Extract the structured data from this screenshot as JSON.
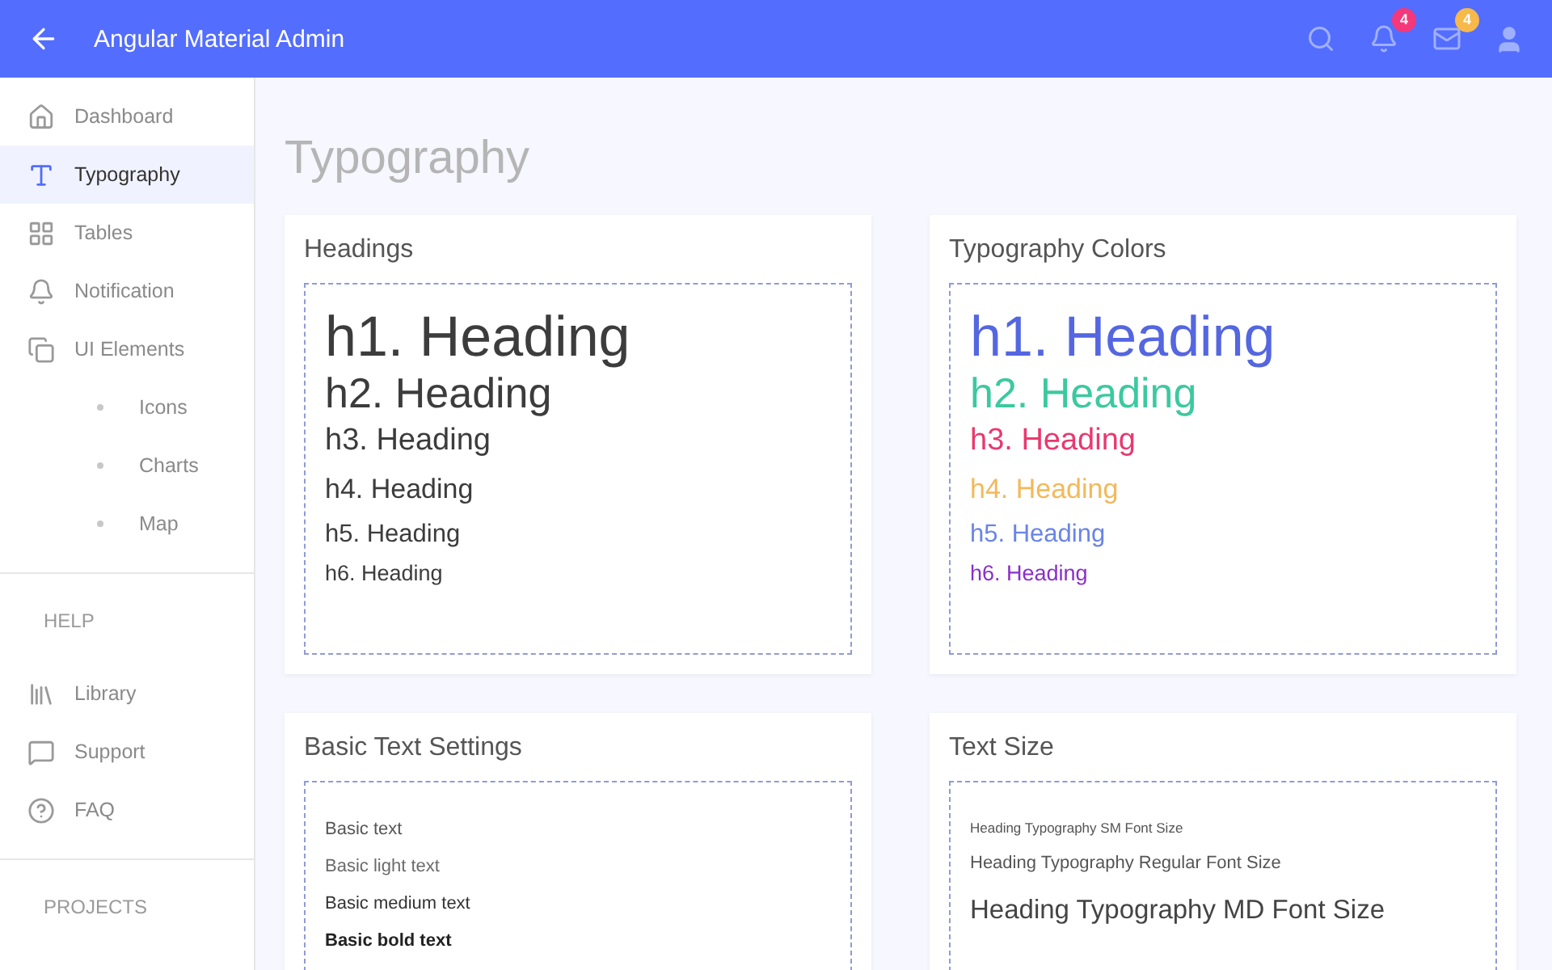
{
  "header": {
    "title": "Angular Material Admin",
    "badges": [
      {
        "kind": "notifications",
        "count": "4",
        "color": "#f4387a"
      },
      {
        "kind": "messages",
        "count": "4",
        "color": "#f6b94a"
      }
    ]
  },
  "sidebar": {
    "items": [
      {
        "kind": "link",
        "label": "Dashboard",
        "selected": false
      },
      {
        "kind": "link",
        "label": "Typography",
        "selected": true
      },
      {
        "kind": "link",
        "label": "Tables",
        "selected": false
      },
      {
        "kind": "link",
        "label": "Notification",
        "selected": false
      },
      {
        "kind": "link",
        "label": "UI Elements",
        "selected": false
      },
      {
        "kind": "sub",
        "label": "Icons",
        "selected": false
      },
      {
        "kind": "sub",
        "label": "Charts",
        "selected": false
      },
      {
        "kind": "sub",
        "label": "Map",
        "selected": false
      },
      {
        "kind": "divider"
      },
      {
        "kind": "header",
        "label": "HELP"
      },
      {
        "kind": "link",
        "label": "Library",
        "selected": false
      },
      {
        "kind": "link",
        "label": "Support",
        "selected": false
      },
      {
        "kind": "link",
        "label": "FAQ",
        "selected": false
      },
      {
        "kind": "divider"
      },
      {
        "kind": "header",
        "label": "PROJECTS"
      }
    ]
  },
  "page_title": "Typography",
  "cards": [
    {
      "kind": "headings",
      "title": "Headings",
      "lines": [
        {
          "text": "h1. Heading",
          "color": "#3c3c3c"
        },
        {
          "text": "h2. Heading",
          "color": "#3c3c3c"
        },
        {
          "text": "h3. Heading",
          "color": "#3c3c3c"
        },
        {
          "text": "h4. Heading",
          "color": "#3c3c3c"
        },
        {
          "text": "h5. Heading",
          "color": "#3c3c3c"
        },
        {
          "text": "h6. Heading",
          "color": "#3c3c3c"
        }
      ]
    },
    {
      "kind": "headings",
      "title": "Typography Colors",
      "lines": [
        {
          "text": "h1. Heading",
          "color": "#5466e0"
        },
        {
          "text": "h2. Heading",
          "color": "#3cc9a0"
        },
        {
          "text": "h3. Heading",
          "color": "#e9386f"
        },
        {
          "text": "h4. Heading",
          "color": "#f3b95a"
        },
        {
          "text": "h5. Heading",
          "color": "#6a84e6"
        },
        {
          "text": "h6. Heading",
          "color": "#8a2fc8"
        }
      ]
    },
    {
      "kind": "text",
      "title": "Basic Text Settings",
      "lines": [
        {
          "kind": "regular",
          "text": "Basic text"
        },
        {
          "kind": "light",
          "text": "Basic light text"
        },
        {
          "kind": "medium",
          "text": "Basic medium text"
        },
        {
          "kind": "bold",
          "text": "Basic bold text"
        }
      ]
    },
    {
      "kind": "text",
      "title": "Text Size",
      "lines": [
        {
          "kind": "sm",
          "text": "Heading Typography SM Font Size"
        },
        {
          "kind": "regular-size",
          "text": "Heading Typography Regular Font Size"
        },
        {
          "kind": "md",
          "text": "Heading Typography MD Font Size"
        }
      ]
    }
  ]
}
